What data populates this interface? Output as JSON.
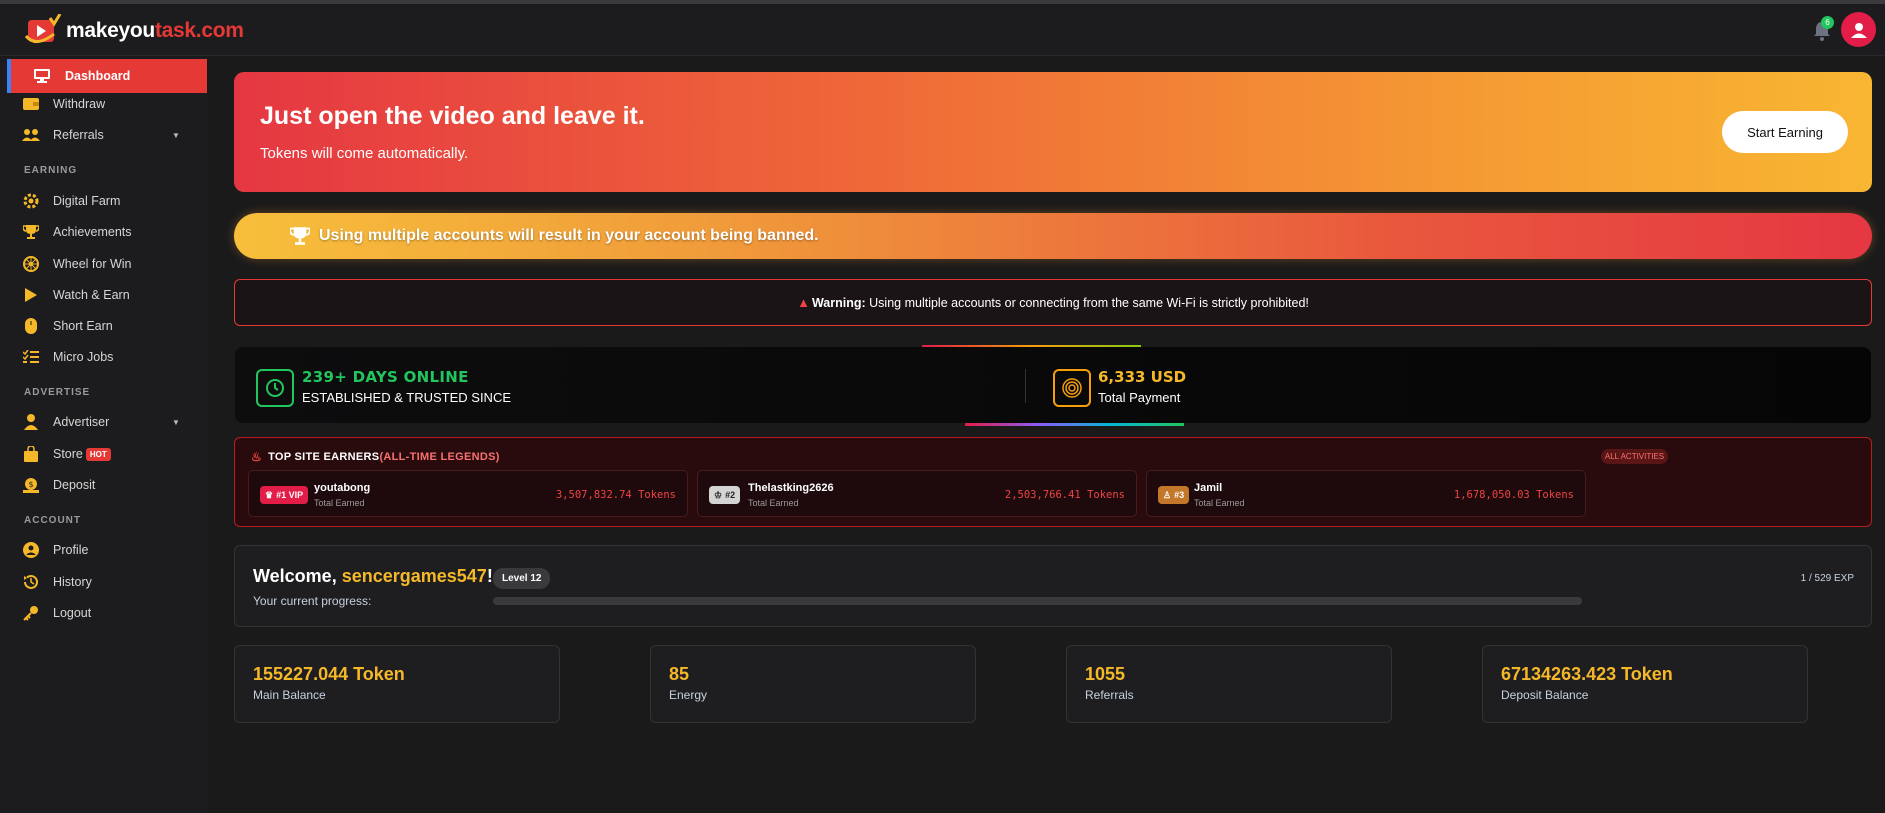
{
  "header": {
    "logo_main": "makeyou",
    "logo_accent": "task.com",
    "notification_count": "6"
  },
  "sidebar": {
    "items": [
      {
        "label": "Dashboard",
        "icon": "monitor-icon"
      },
      {
        "label": "Withdraw",
        "icon": "wallet-icon"
      },
      {
        "label": "Referrals",
        "icon": "users-icon"
      }
    ],
    "section_earning": "EARNING",
    "earning_items": [
      {
        "label": "Digital Farm",
        "icon": "gear-icon"
      },
      {
        "label": "Achievements",
        "icon": "trophy-icon"
      },
      {
        "label": "Wheel for Win",
        "icon": "wheel-icon"
      },
      {
        "label": "Watch & Earn",
        "icon": "play-icon"
      },
      {
        "label": "Short Earn",
        "icon": "mouse-icon"
      },
      {
        "label": "Micro Jobs",
        "icon": "list-icon"
      }
    ],
    "section_advertise": "ADVERTISE",
    "advertise_items": [
      {
        "label": "Advertiser",
        "icon": "user-tie-icon"
      },
      {
        "label": "Store",
        "icon": "bag-icon",
        "badge": "HOT"
      },
      {
        "label": "Deposit",
        "icon": "deposit-icon"
      }
    ],
    "section_account": "ACCOUNT",
    "account_items": [
      {
        "label": "Profile",
        "icon": "user-circle-icon"
      },
      {
        "label": "History",
        "icon": "history-icon"
      },
      {
        "label": "Logout",
        "icon": "key-icon"
      }
    ]
  },
  "hero": {
    "title": "Just open the video and leave it.",
    "subtitle": "Tokens will come automatically.",
    "button": "Start Earning"
  },
  "banner": {
    "text": "Using multiple accounts will result in your account being banned."
  },
  "warning": {
    "label": "Warning:",
    "text": " Using multiple accounts or connecting from the same Wi-Fi is strictly prohibited!"
  },
  "stats": {
    "days": "239+ DAYS ONLINE",
    "days_sub": "ESTABLISHED & TRUSTED SINCE",
    "payment": "6,333 USD",
    "payment_sub": "Total Payment"
  },
  "top_earners": {
    "title": "TOP SITE EARNERS ",
    "title_accent": "(ALL-TIME LEGENDS)",
    "all_activities": "ALL ACTIVITIES",
    "earners": [
      {
        "rank": "#1 VIP",
        "name": "youtabong",
        "sub": "Total Earned",
        "amount": "3,507,832.74 Tokens"
      },
      {
        "rank": "#2",
        "name": "Thelastking2626",
        "sub": "Total Earned",
        "amount": "2,503,766.41 Tokens"
      },
      {
        "rank": "#3",
        "name": "Jamil",
        "sub": "Total Earned",
        "amount": "1,678,050.03 Tokens"
      }
    ]
  },
  "welcome": {
    "prefix": "Welcome, ",
    "username": "sencergames547",
    "suffix": "!",
    "sub": "Your current progress:",
    "level": "Level 12",
    "exp": "1 / 529 EXP"
  },
  "cards": [
    {
      "value": "155227.044 Token",
      "label": "Main Balance"
    },
    {
      "value": "85",
      "label": "Energy"
    },
    {
      "value": "1055",
      "label": "Referrals"
    },
    {
      "value": "67134263.423 Token",
      "label": "Deposit Balance"
    }
  ],
  "colors": {
    "accent_red": "#e53935",
    "accent_gold": "#f5b829",
    "green": "#22c55e"
  }
}
